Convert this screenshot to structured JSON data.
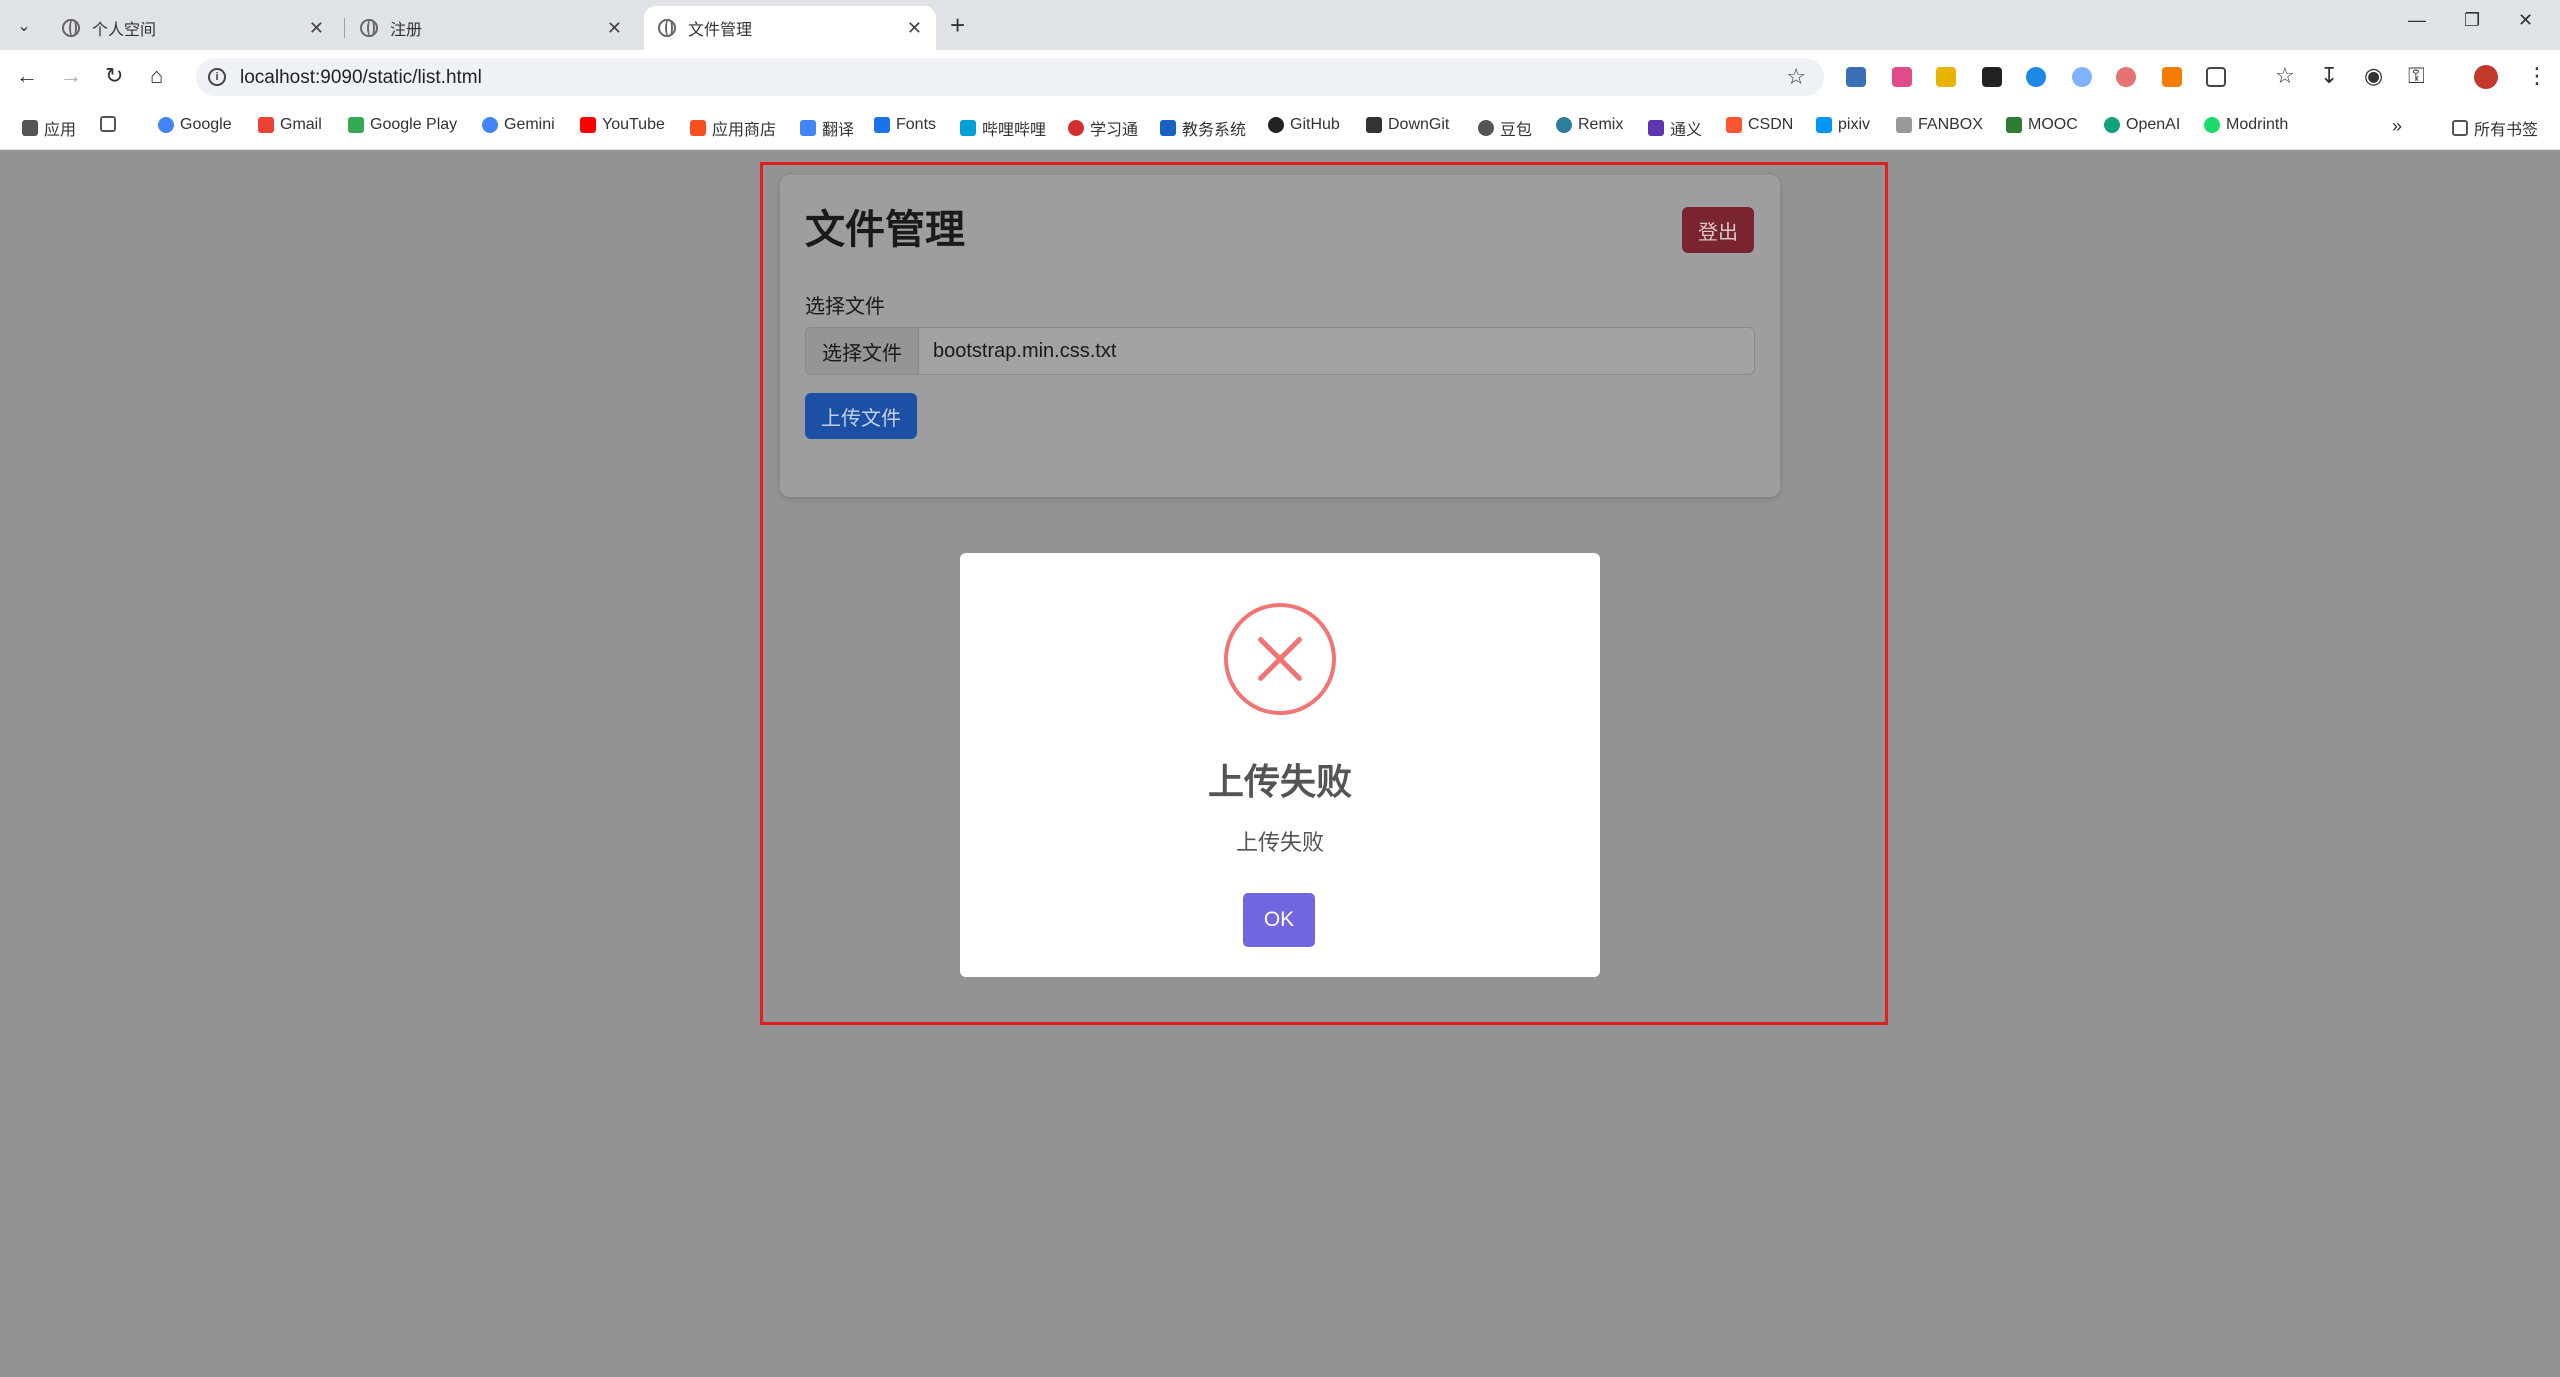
{
  "tabs": [
    {
      "title": "个人空间"
    },
    {
      "title": "注册"
    },
    {
      "title": "文件管理"
    }
  ],
  "address_bar": {
    "url": "localhost:9090/static/list.html"
  },
  "bookmarks": [
    "应用",
    "Google",
    "Gmail",
    "Google Play",
    "Gemini",
    "YouTube",
    "应用商店",
    "翻译",
    "Fonts",
    "哔哩哔哩",
    "学习通",
    "教务系统",
    "GitHub",
    "DownGit",
    "豆包",
    "Remix",
    "通义",
    "CSDN",
    "pixiv",
    "FANBOX",
    "MOOC",
    "OpenAI",
    "Modrinth"
  ],
  "all_bookmarks": "所有书签",
  "page": {
    "title": "文件管理",
    "logout_label": "登出",
    "file_label": "选择文件",
    "choose_button": "选择文件",
    "file_name": "bootstrap.min.css.txt",
    "upload_label": "上传文件"
  },
  "modal": {
    "icon": "error-x-icon",
    "title": "上传失败",
    "text": "上传失败",
    "ok_label": "OK"
  },
  "colors": {
    "logout": "#dc3545",
    "upload": "#0d6efd",
    "ok": "#7066e0",
    "error": "#f27474",
    "highlight_frame": "#e02020"
  }
}
